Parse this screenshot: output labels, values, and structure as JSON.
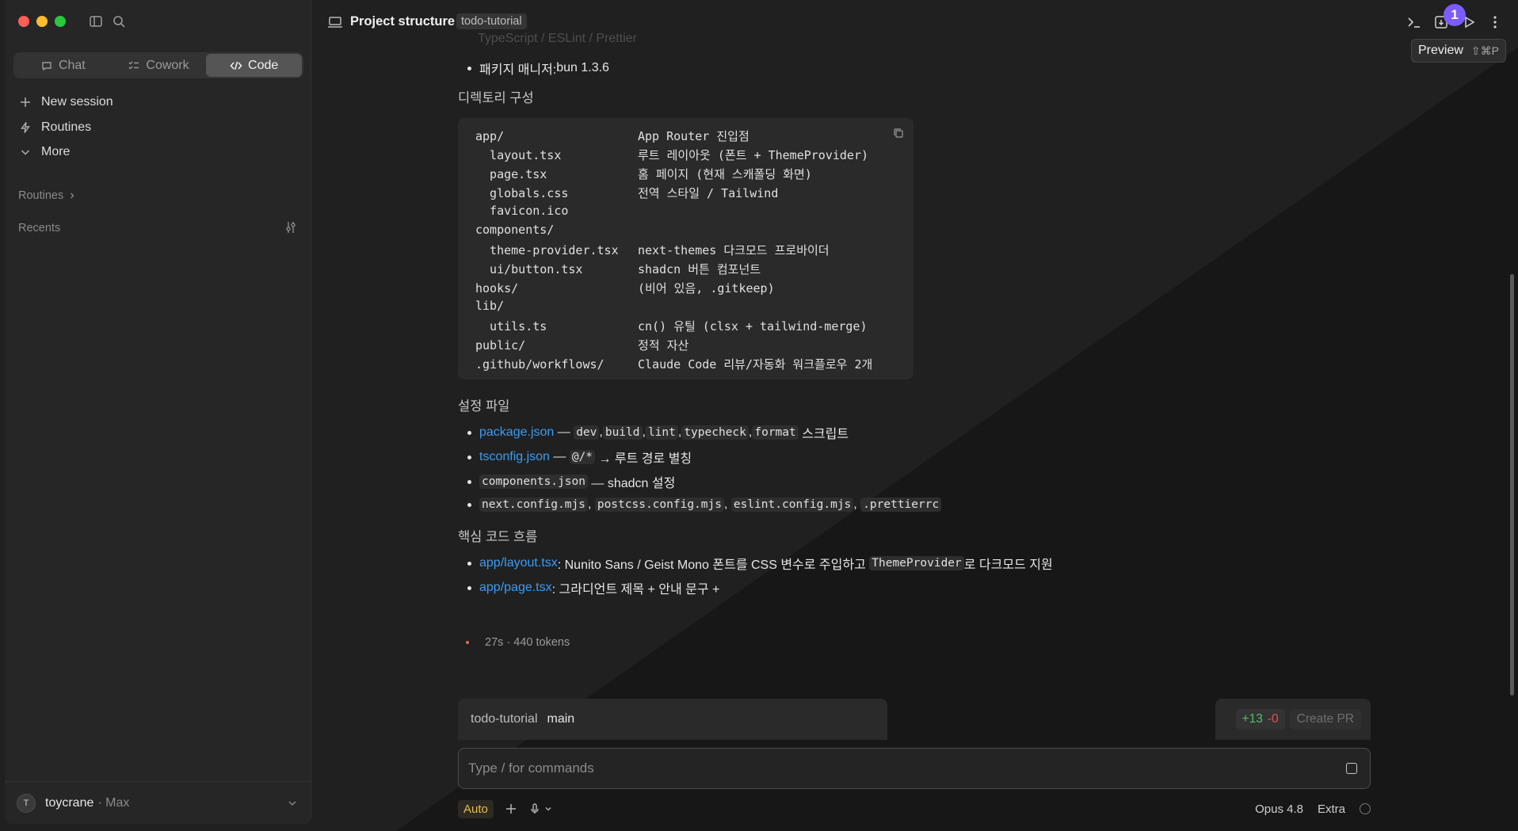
{
  "window": {
    "traffic_lights": [
      "close",
      "minimize",
      "zoom"
    ]
  },
  "sidebar": {
    "mode_tabs": [
      {
        "label": "Chat",
        "icon": "chat-bubble-icon",
        "active": false
      },
      {
        "label": "Cowork",
        "icon": "checklist-icon",
        "active": false
      },
      {
        "label": "Code",
        "icon": "code-icon",
        "active": true
      }
    ],
    "nav": [
      {
        "label": "New session",
        "icon": "plus-icon"
      },
      {
        "label": "Routines",
        "icon": "bolt-icon"
      },
      {
        "label": "More",
        "icon": "chevron-down-icon"
      }
    ],
    "routines_label": "Routines",
    "recents_label": "Recents",
    "user": {
      "initial": "T",
      "name": "toycrane",
      "plan": "· Max"
    }
  },
  "header": {
    "title": "Project structure",
    "badge": "todo-tutorial",
    "notification_count": "1",
    "tooltip": {
      "label": "Preview",
      "shortcut": "⇧⌘P"
    }
  },
  "content": {
    "faded_line": "TypeScript / ESLint / Prettier",
    "package_manager": {
      "label": "패키지 매니저: ",
      "value": "bun 1.3.6"
    },
    "dir_heading": "디렉토리 구성",
    "code_rows": [
      {
        "path": "app/",
        "desc": "App Router 진입점"
      },
      {
        "path": "  layout.tsx",
        "desc": "루트 레이아웃 (폰트 + ThemeProvider)"
      },
      {
        "path": "  page.tsx",
        "desc": "홈 페이지 (현재 스캐폴딩 화면)"
      },
      {
        "path": "  globals.css",
        "desc": "전역 스타일 / Tailwind"
      },
      {
        "path": "  favicon.ico",
        "desc": ""
      },
      {
        "path": "components/",
        "desc": ""
      },
      {
        "path": "  theme-provider.tsx",
        "desc": "next-themes 다크모드 프로바이더"
      },
      {
        "path": "  ui/button.tsx",
        "desc": "shadcn 버튼 컴포넌트"
      },
      {
        "path": "hooks/",
        "desc": "(비어 있음, .gitkeep)"
      },
      {
        "path": "lib/",
        "desc": ""
      },
      {
        "path": "  utils.ts",
        "desc": "cn() 유틸 (clsx + tailwind-merge)"
      },
      {
        "path": "public/",
        "desc": "정적 자산"
      },
      {
        "path": ".github/workflows/",
        "desc": "Claude Code 리뷰/자동화 워크플로우 2개"
      }
    ],
    "config_heading": "설정 파일",
    "config": {
      "pkg_link": "package.json",
      "pkg_dash": " — ",
      "pkg_scripts": [
        "dev",
        "build",
        "lint",
        "typecheck",
        "format"
      ],
      "pkg_suffix": " 스크립트",
      "ts_link": "tsconfig.json",
      "ts_dash": " — ",
      "ts_alias": "@/*",
      "ts_suffix": " → 루트 경로 별칭",
      "comp_code": "components.json",
      "comp_suffix": " — shadcn 설정",
      "misc_files": [
        "next.config.mjs",
        "postcss.config.mjs",
        "eslint.config.mjs",
        ".prettierrc"
      ]
    },
    "core_heading": "핵심 코드 흐름",
    "core": {
      "layout_link": "app/layout.tsx",
      "layout_text": ": Nunito Sans / Geist Mono 폰트를 CSS 변수로 주입하고 ",
      "layout_code": "ThemeProvider",
      "layout_suffix": "로 다크모드 지원",
      "page_link": "app/page.tsx",
      "page_text": ": 그라디언트 제목 + 안내 문구 +"
    },
    "stats": "27s · 440 tokens"
  },
  "composer": {
    "repo": "todo-tutorial",
    "branch": "main",
    "diff_add": "+13",
    "diff_del": "-0",
    "create_pr": "Create PR",
    "placeholder": "Type / for commands",
    "mode": "Auto",
    "model": "Opus 4.8",
    "effort": "Extra"
  }
}
